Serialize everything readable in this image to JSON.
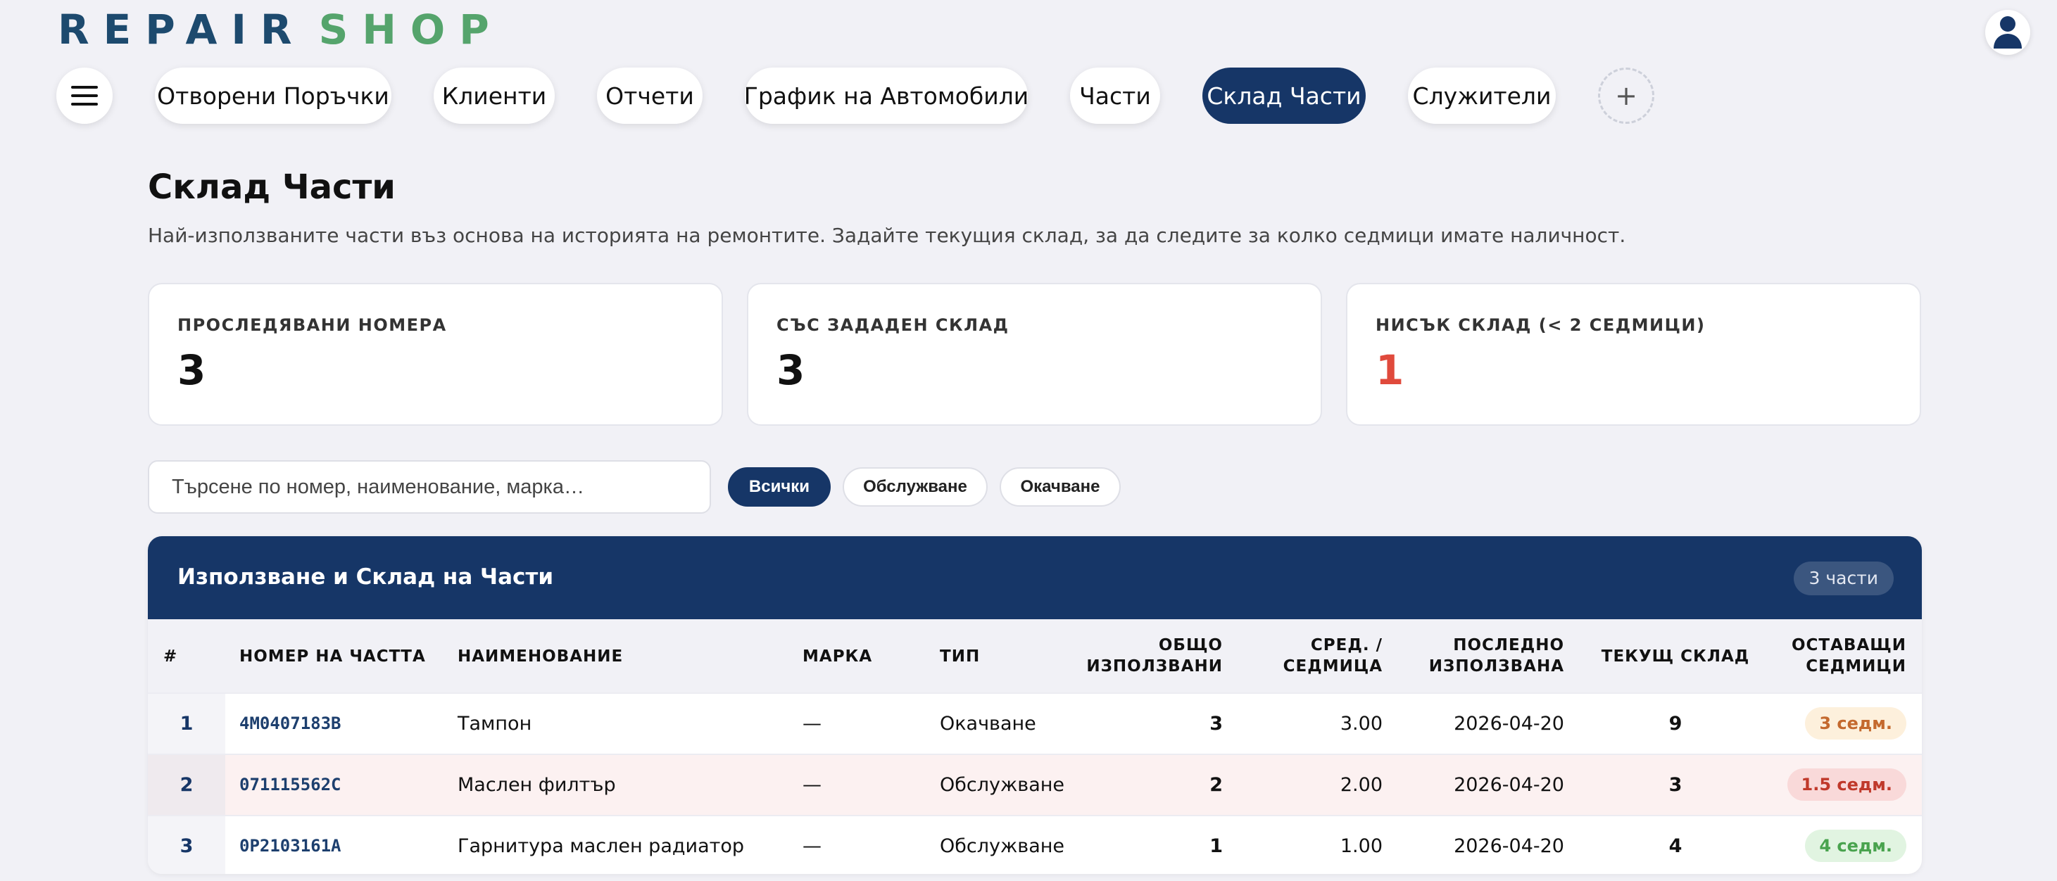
{
  "app": {
    "logo_word1": "REPAIR",
    "logo_word2": "SHOP"
  },
  "nav": {
    "items": [
      {
        "label": "Отворени Поръчки"
      },
      {
        "label": "Клиенти"
      },
      {
        "label": "Отчети"
      },
      {
        "label": "График на Автомобили"
      },
      {
        "label": "Части"
      },
      {
        "label": "Склад Части",
        "active": true
      },
      {
        "label": "Служители"
      }
    ],
    "add_label": "+"
  },
  "page": {
    "title": "Склад Части",
    "subtitle": "Най-използваните части въз основа на историята на ремонтите. Задайте текущия склад, за да следите за колко седмици имате наличност."
  },
  "stats": [
    {
      "label": "ПРОСЛЕДЯВАНИ НОМЕРА",
      "value": "3"
    },
    {
      "label": "СЪС ЗАДАДЕН СКЛАД",
      "value": "3"
    },
    {
      "label": "НИСЪК СКЛАД (< 2 СЕДМИЦИ)",
      "value": "1",
      "color": "#e04a3c"
    }
  ],
  "search": {
    "placeholder": "Търсене по номер, наименование, марка…",
    "value": ""
  },
  "filters": [
    {
      "label": "Всички",
      "active": true
    },
    {
      "label": "Обслужване"
    },
    {
      "label": "Окачване"
    }
  ],
  "table": {
    "title": "Използване и Склад на Части",
    "count_label": "3 части",
    "headers": {
      "idx": "#",
      "part_number": "НОМЕР НА ЧАСТТА",
      "name": "НАИМЕНОВАНИЕ",
      "brand": "МАРКА",
      "type": "ТИП",
      "total_used_1": "ОБЩО",
      "total_used_2": "ИЗПОЛЗВАНИ",
      "avg_week_1": "СРЕД. /",
      "avg_week_2": "СЕДМИЦА",
      "last_used_1": "ПОСЛЕДНО",
      "last_used_2": "ИЗПОЛЗВАНА",
      "current_stock": "ТЕКУЩ СКЛАД",
      "weeks_left_1": "ОСТАВАЩИ",
      "weeks_left_2": "СЕДМИЦИ"
    },
    "rows": [
      {
        "idx": "1",
        "part_number": "4M0407183B",
        "name": "Тампон",
        "brand": "—",
        "type": "Окачване",
        "total_used": "3",
        "avg_week": "3.00",
        "last_used": "2026-04-20",
        "current_stock": "9",
        "weeks_left": "3 седм.",
        "status": "warn"
      },
      {
        "idx": "2",
        "part_number": "071115562C",
        "name": "Маслен филтър",
        "brand": "—",
        "type": "Обслужване",
        "total_used": "2",
        "avg_week": "2.00",
        "last_used": "2026-04-20",
        "current_stock": "3",
        "weeks_left": "1.5 седм.",
        "status": "low"
      },
      {
        "idx": "3",
        "part_number": "0P2103161A",
        "name": "Гарнитура маслен радиатор",
        "brand": "—",
        "type": "Обслужване",
        "total_used": "1",
        "avg_week": "1.00",
        "last_used": "2026-04-20",
        "current_stock": "4",
        "weeks_left": "4 седм.",
        "status": "ok"
      }
    ]
  },
  "colors": {
    "primary": "#163667",
    "accent_green": "#55a46c",
    "danger": "#e04a3c"
  },
  "icons": {
    "menu": "hamburger-icon",
    "user": "user-icon",
    "add": "plus-icon"
  }
}
